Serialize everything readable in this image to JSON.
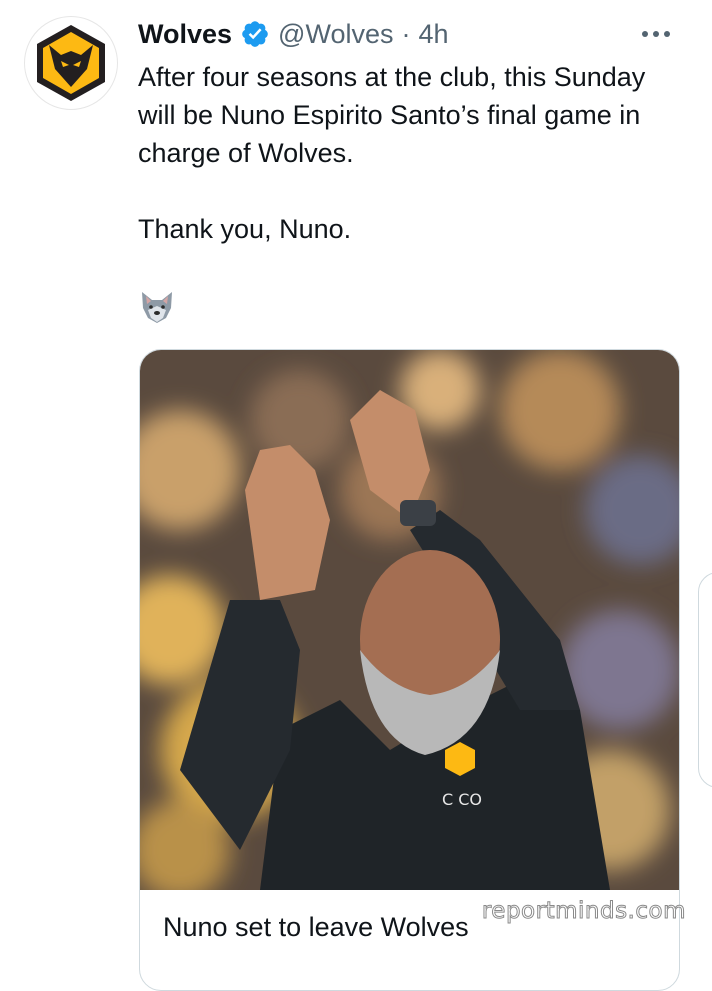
{
  "tweet": {
    "display_name": "Wolves",
    "verified": true,
    "handle": "@Wolves",
    "separator": "·",
    "time": "4h",
    "text": "After four seasons at the club, this Sunday will be Nuno Espirito Santo’s final game in charge of Wolves.\n\nThank you, Nuno.",
    "emoji_icon": "wolf-face-icon",
    "more_icon": "more-options-icon"
  },
  "card": {
    "title": "Nuno set to leave Wolves"
  },
  "watermark": "reportminds.com",
  "colors": {
    "brand_orange": "#FDB913",
    "brand_black": "#231F20",
    "verified_blue": "#1D9BF0",
    "secondary_text": "#536471"
  }
}
